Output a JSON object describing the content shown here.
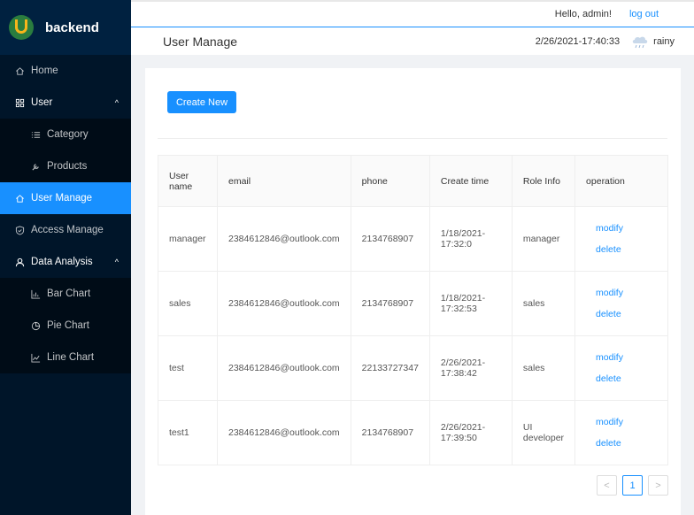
{
  "app": {
    "name": "backend"
  },
  "sidebar": {
    "items": [
      {
        "label": "Home",
        "icon": "home-icon"
      },
      {
        "label": "User",
        "icon": "grid-icon",
        "caret": "^"
      },
      {
        "label": "Category",
        "icon": "list-icon"
      },
      {
        "label": "Products",
        "icon": "tool-icon"
      },
      {
        "label": "User Manage",
        "icon": "home-icon"
      },
      {
        "label": "Access Manage",
        "icon": "shield-icon"
      },
      {
        "label": "Data Analysis",
        "icon": "user-icon",
        "caret": "^"
      },
      {
        "label": "Bar Chart",
        "icon": "bar-chart-icon"
      },
      {
        "label": "Pie Chart",
        "icon": "pie-chart-icon"
      },
      {
        "label": "Line Chart",
        "icon": "line-chart-icon"
      }
    ]
  },
  "header": {
    "greeting": "Hello, admin!",
    "logout": "log out",
    "page_title": "User Manage",
    "datetime": "2/26/2021-17:40:33",
    "weather": "rainy"
  },
  "toolbar": {
    "create_label": "Create New"
  },
  "table": {
    "columns": [
      "User name",
      "email",
      "phone",
      "Create time",
      "Role Info",
      "operation"
    ],
    "rows": [
      {
        "name": "manager",
        "email": "2384612846@outlook.com",
        "phone": "2134768907",
        "time": "1/18/2021-17:32:0",
        "role": "manager"
      },
      {
        "name": "sales",
        "email": "2384612846@outlook.com",
        "phone": "2134768907",
        "time": "1/18/2021-17:32:53",
        "role": "sales"
      },
      {
        "name": "test",
        "email": "2384612846@outlook.com",
        "phone": "22133727347",
        "time": "2/26/2021-17:38:42",
        "role": "sales"
      },
      {
        "name": "test1",
        "email": "2384612846@outlook.com",
        "phone": "2134768907",
        "time": "2/26/2021-17:39:50",
        "role": "UI developer"
      }
    ],
    "modify_label": "modify",
    "delete_label": "delete"
  },
  "pagination": {
    "prev": "<",
    "current": "1",
    "next": ">"
  },
  "colors": {
    "accent": "#1890ff",
    "sidebar": "#001529",
    "submenu": "#000c17"
  }
}
